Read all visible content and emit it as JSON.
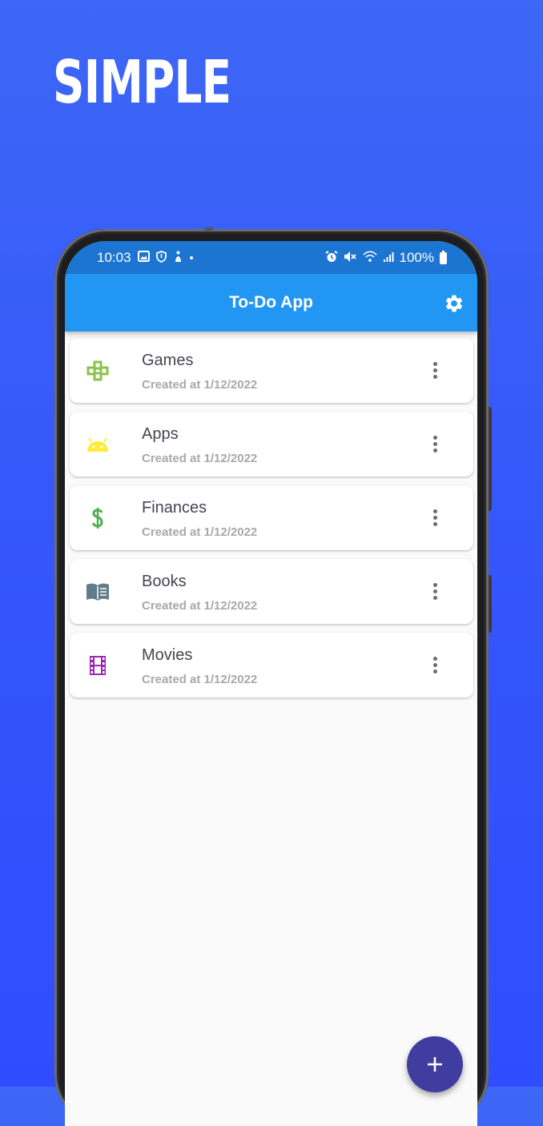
{
  "promo": {
    "headline": "SIMPLE"
  },
  "status_bar": {
    "time": "10:03",
    "battery": "100%"
  },
  "app_bar": {
    "title": "To-Do App"
  },
  "categories": [
    {
      "title": "Games",
      "subtitle": "Created at 1/12/2022",
      "icon": "gamepad-icon",
      "icon_color": "#8bc34a"
    },
    {
      "title": "Apps",
      "subtitle": "Created at 1/12/2022",
      "icon": "android-icon",
      "icon_color": "#ffeb3b"
    },
    {
      "title": "Finances",
      "subtitle": "Created at 1/12/2022",
      "icon": "dollar-icon",
      "icon_color": "#4caf50"
    },
    {
      "title": "Books",
      "subtitle": "Created at 1/12/2022",
      "icon": "book-icon",
      "icon_color": "#607d8b"
    },
    {
      "title": "Movies",
      "subtitle": "Created at 1/12/2022",
      "icon": "movie-icon",
      "icon_color": "#9c27b0"
    }
  ],
  "fab": {
    "label": "+"
  },
  "colors": {
    "background": "#3355fb",
    "status_bar": "#1d75d2",
    "app_bar": "#2196f3",
    "fab": "#3f3da0"
  }
}
